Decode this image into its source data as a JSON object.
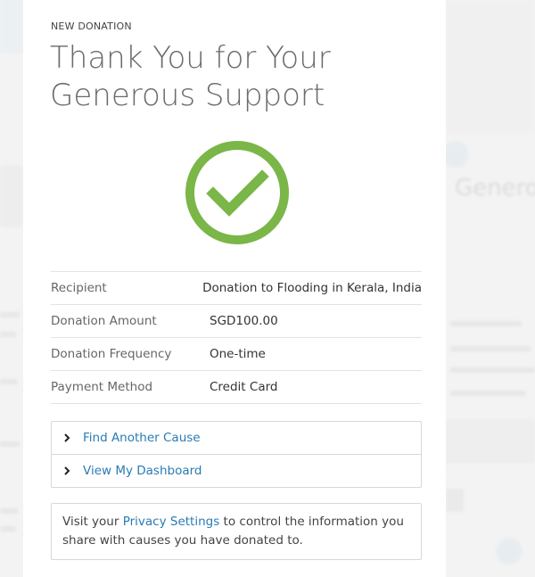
{
  "modal": {
    "eyebrow": "NEW DONATION",
    "title_line1": "Thank You for Your",
    "title_line2": "Generous Support",
    "success_icon": "check-circle-icon",
    "success_color": "#7ab648"
  },
  "details": [
    {
      "label": "Recipient",
      "value": "Donation to Flooding in Kerala, India"
    },
    {
      "label": "Donation Amount",
      "value": "SGD100.00"
    },
    {
      "label": "Donation Frequency",
      "value": "One-time"
    },
    {
      "label": "Payment Method",
      "value": "Credit Card"
    }
  ],
  "actions": [
    {
      "label": "Find Another Cause",
      "icon": "chevron-right-icon"
    },
    {
      "label": "View My Dashboard",
      "icon": "chevron-right-icon"
    }
  ],
  "privacy": {
    "prefix": "Visit your ",
    "link": "Privacy Settings",
    "suffix": " to control the information you share with causes you have donated to."
  },
  "background": {
    "heading_fragment": "Generou",
    "brand_icon": "hp-logo-icon"
  },
  "colors": {
    "link": "#2a7bb3",
    "background": "#f3f3f3"
  }
}
